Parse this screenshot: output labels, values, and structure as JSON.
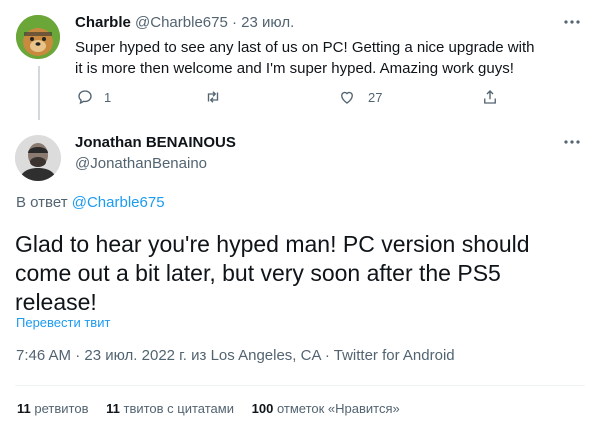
{
  "parent_tweet": {
    "author_name": "Charble",
    "author_handle": "@Charble675",
    "separator": "·",
    "date": "23 июл.",
    "text": "Super hyped to see any last of us on PC! Getting a nice upgrade with it is more then welcome and I'm super hyped. Amazing work guys!",
    "reply_count": "1",
    "like_count": "27"
  },
  "main_tweet": {
    "author_name": "Jonathan BENAINOUS",
    "author_handle": "@JonathanBenaino",
    "reply_prefix": "В ответ",
    "reply_handle": "@Charble675",
    "text": "Glad to hear you're hyped man! PC version should come out a bit later, but very soon after the PS5 release!",
    "translate_label": "Перевести твит",
    "time": "7:46 AM",
    "date": "23 июл. 2022 г. из",
    "location": "Los Angeles, CA",
    "source": "Twitter for Android",
    "dot": "·"
  },
  "stats": {
    "retweets_count": "11",
    "retweets_label": "ретвитов",
    "quotes_count": "11",
    "quotes_label": "твитов с цитатами",
    "likes_count": "100",
    "likes_label": "отметок «Нравится»"
  },
  "icons": {
    "more": "more-icon",
    "reply": "reply-icon",
    "retweet": "retweet-icon",
    "like": "like-icon",
    "share": "share-icon"
  },
  "colors": {
    "link": "#1d9bf0",
    "muted": "#536471",
    "text": "#0f1419"
  }
}
